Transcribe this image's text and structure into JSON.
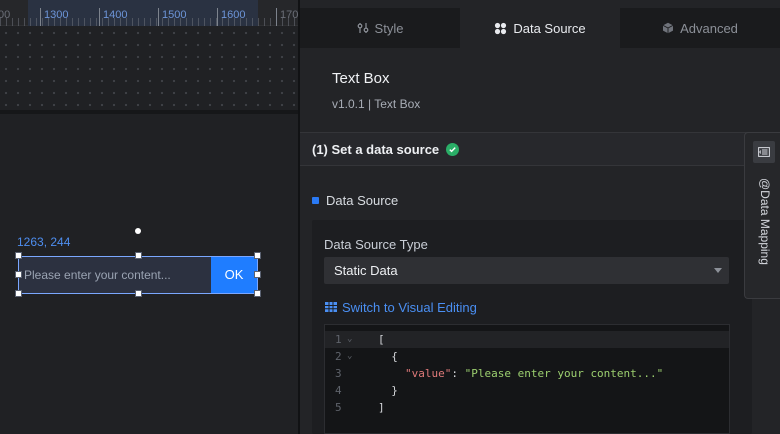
{
  "canvas": {
    "ruler_labels": [
      "00",
      "1300",
      "1400",
      "1500",
      "1600",
      "170"
    ],
    "coordinates": "1263, 244",
    "widget": {
      "placeholder": "Please enter your content...",
      "button_label": "OK"
    }
  },
  "panel": {
    "tabs": [
      {
        "label": "Style",
        "icon": "style-icon",
        "active": false
      },
      {
        "label": "Data Source",
        "icon": "data-source-icon",
        "active": true
      },
      {
        "label": "Advanced",
        "icon": "cube-icon",
        "active": false
      }
    ],
    "component_title": "Text Box",
    "component_version": "v1.0.1 | Text Box",
    "section_title": "(1) Set a data source",
    "data_source_label": "Data Source",
    "data_source_type_label": "Data Source Type",
    "data_source_type_value": "Static Data",
    "switch_label": "Switch to Visual Editing",
    "code_lines": [
      {
        "num": "1",
        "fold": true,
        "text": "["
      },
      {
        "num": "2",
        "fold": true,
        "text": "  {"
      },
      {
        "num": "3",
        "fold": false,
        "key": "\"value\"",
        "sep": ": ",
        "value": "\"Please enter your content...\""
      },
      {
        "num": "4",
        "fold": false,
        "text": "  }"
      },
      {
        "num": "5",
        "fold": false,
        "text": "]"
      }
    ]
  },
  "side_tab": {
    "label": "@Data Mapping"
  },
  "colors": {
    "accent": "#1f7dff",
    "success": "#2aae67",
    "link": "#4a8ff3"
  }
}
